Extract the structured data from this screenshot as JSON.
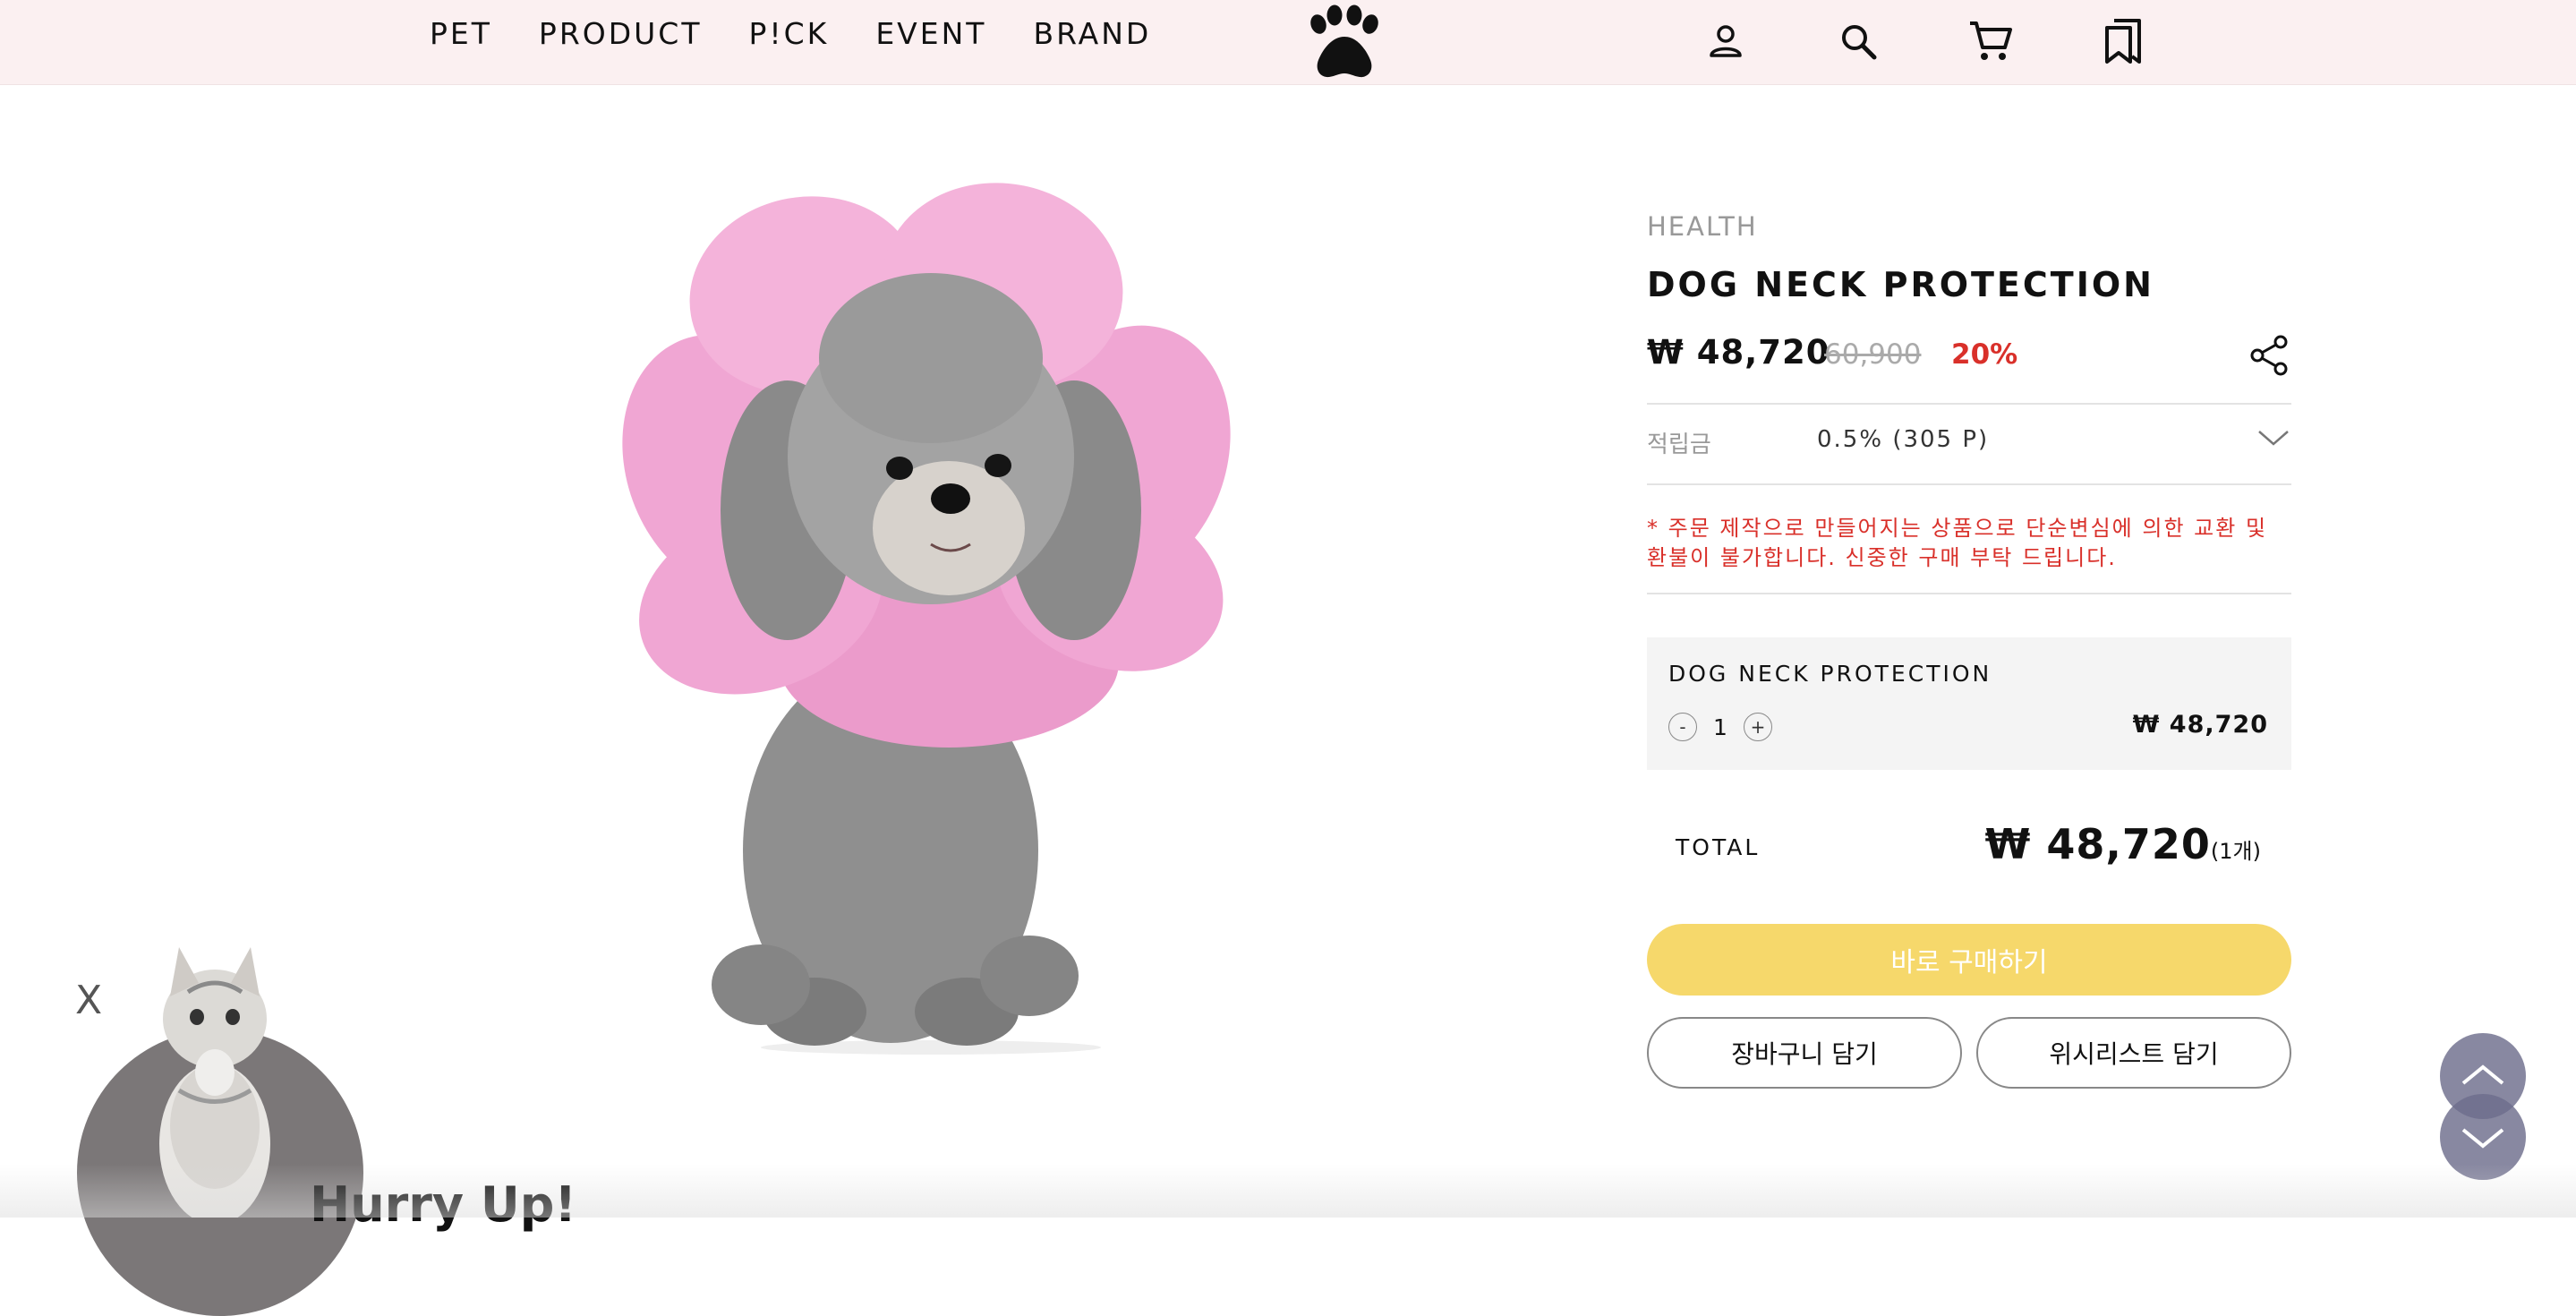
{
  "nav": {
    "items": [
      {
        "label": "PET"
      },
      {
        "label": "PRODUCT"
      },
      {
        "label": "P!CK"
      },
      {
        "label": "EVENT"
      },
      {
        "label": "BRAND"
      }
    ],
    "logo_icon": "paw-icon",
    "icons": [
      "user-icon",
      "search-icon",
      "cart-icon",
      "bookmark-icon"
    ]
  },
  "product": {
    "category": "HEALTH",
    "name": "DOG NECK PROTECTION",
    "price": "₩ 48,720",
    "original_price": "60,900",
    "discount": "20%",
    "points_label": "적립금",
    "points_value": "0.5% (305 P)",
    "notice": "* 주문 제작으로 만들어지는 상품으로 단순변심에 의한 교환 및 환불이 불가합니다. 신중한 구매 부탁 드립니다.",
    "option": {
      "name": "DOG NECK PROTECTION",
      "minus": "-",
      "quantity": "1",
      "plus": "+",
      "price": "₩ 48,720"
    },
    "total_label": "TOTAL",
    "total_price": "₩ 48,720",
    "total_count": "(1개)",
    "buy_label": "바로 구매하기",
    "cart_label": "장바구니 담기",
    "wishlist_label": "위시리스트 담기"
  },
  "popup": {
    "close": "X",
    "headline": "Hurry Up!"
  },
  "colors": {
    "topbar_bg": "#fbf0f1",
    "discount_red": "#d9302a",
    "buy_yellow": "#f6d86b",
    "pink_collar": "#f2a9d6"
  }
}
